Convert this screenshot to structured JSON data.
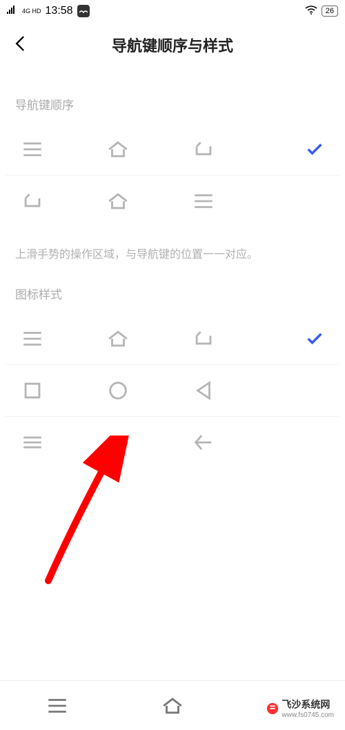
{
  "status_bar": {
    "signal_label": "4G HD",
    "time": "13:58",
    "battery": "26"
  },
  "header": {
    "title": "导航键顺序与样式"
  },
  "sections": {
    "order_label": "导航键顺序",
    "hint": "上滑手势的操作区域，与导航键的位置一一对应。",
    "style_label": "图标样式"
  },
  "watermark": {
    "text": "飞沙系统网",
    "url": "www.fs0745.com"
  },
  "icons": {
    "menu": "menu",
    "home": "home",
    "back": "back",
    "square": "square",
    "circle": "circle",
    "triangle": "triangle",
    "pill": "pill",
    "arrow_left": "arrow-left"
  }
}
